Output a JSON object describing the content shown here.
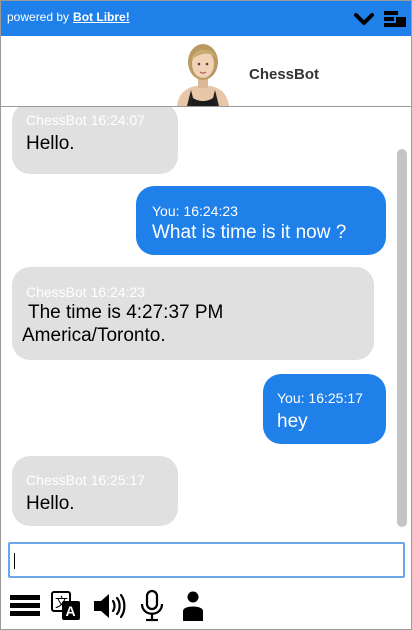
{
  "topbar": {
    "powered_text": "powered by",
    "powered_link": "Bot Libre!",
    "color": "#1f80ea"
  },
  "header": {
    "bot_name": "ChessBot"
  },
  "messages": [
    {
      "from": "bot",
      "meta": "ChessBot 16:24:07",
      "lines": [
        "Hello."
      ]
    },
    {
      "from": "user",
      "meta": "You: 16:24:23",
      "lines": [
        "What is time is it now ?"
      ]
    },
    {
      "from": "bot",
      "meta": "ChessBot 16:24:23",
      "lines": [
        "The time is 4:27:37 PM",
        "America/Toronto."
      ]
    },
    {
      "from": "user",
      "meta": "You: 16:25:17",
      "lines": [
        "hey"
      ]
    },
    {
      "from": "bot",
      "meta": "ChessBot 16:25:17",
      "lines": [
        "Hello."
      ]
    }
  ],
  "input": {
    "value": "",
    "placeholder": ""
  },
  "toolbar": {
    "icons": [
      "menu-icon",
      "translate-icon",
      "speaker-icon",
      "microphone-icon",
      "avatar-toggle-icon"
    ]
  },
  "colors": {
    "user_bubble": "#1f80ea",
    "bot_bubble": "#e0e0e0"
  }
}
